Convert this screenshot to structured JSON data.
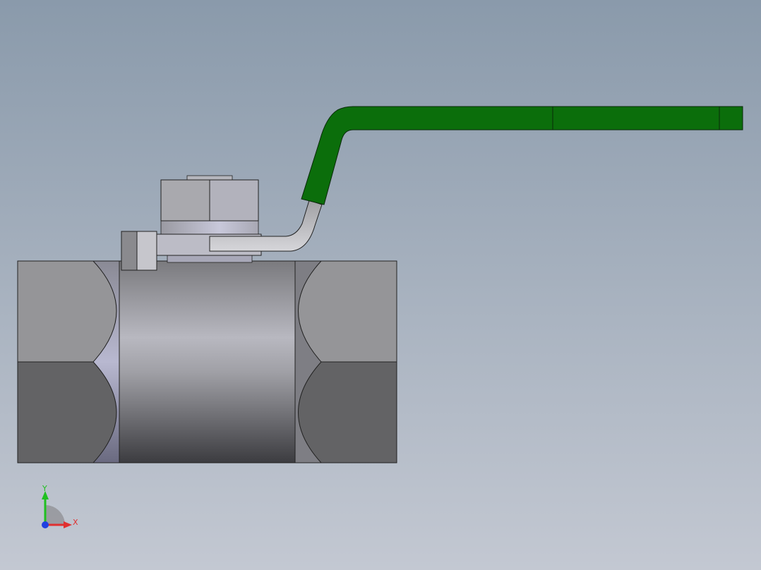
{
  "viewport": {
    "background_top": "#8a9aab",
    "background_bottom": "#c3c8d2"
  },
  "model": {
    "handle_color": "#0b6e0b",
    "stem_color": "#c8c8cc",
    "body_color": "#8e8e92",
    "end_light": "#959598",
    "end_dark": "#636365"
  },
  "triad": {
    "x_label": "X",
    "y_label": "Y",
    "x_color": "#e03030",
    "y_color": "#20c020",
    "z_color": "#2040e0"
  }
}
